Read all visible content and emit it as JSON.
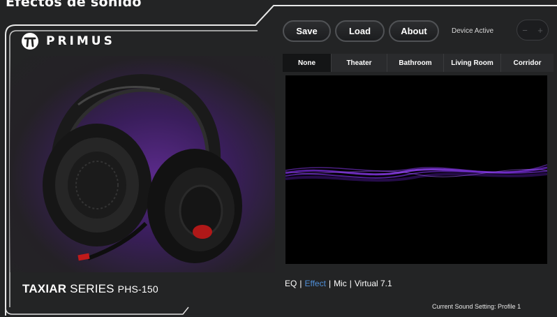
{
  "page": {
    "heading": "Efectos de sonido"
  },
  "brand": {
    "name": "PRIMUS",
    "logo_icon": "pi-icon"
  },
  "product": {
    "name": "TAXIAR",
    "series": "SERIES",
    "model": "PHS-150"
  },
  "toolbar": {
    "save_label": "Save",
    "load_label": "Load",
    "about_label": "About"
  },
  "device": {
    "status": "Device Active",
    "toggle_left": "−",
    "toggle_right": "+"
  },
  "tabs": [
    {
      "label": "None",
      "active": true
    },
    {
      "label": "Theater",
      "active": false
    },
    {
      "label": "Bathroom",
      "active": false
    },
    {
      "label": "Living Room",
      "active": false
    },
    {
      "label": "Corridor",
      "active": false
    }
  ],
  "bottom_nav": {
    "items": [
      {
        "label": "EQ",
        "active": false
      },
      {
        "label": "Effect",
        "active": true
      },
      {
        "label": "Mic",
        "active": false
      },
      {
        "label": "Virtual 7.1",
        "active": false
      }
    ],
    "separator": "|"
  },
  "status": {
    "current_sound_setting": "Current Sound Setting: Profile 1"
  },
  "colors": {
    "accent_purple": "#7a3ad0",
    "active_link": "#4f8fd8",
    "background": "#232425",
    "visualizer_bg": "#000000"
  }
}
